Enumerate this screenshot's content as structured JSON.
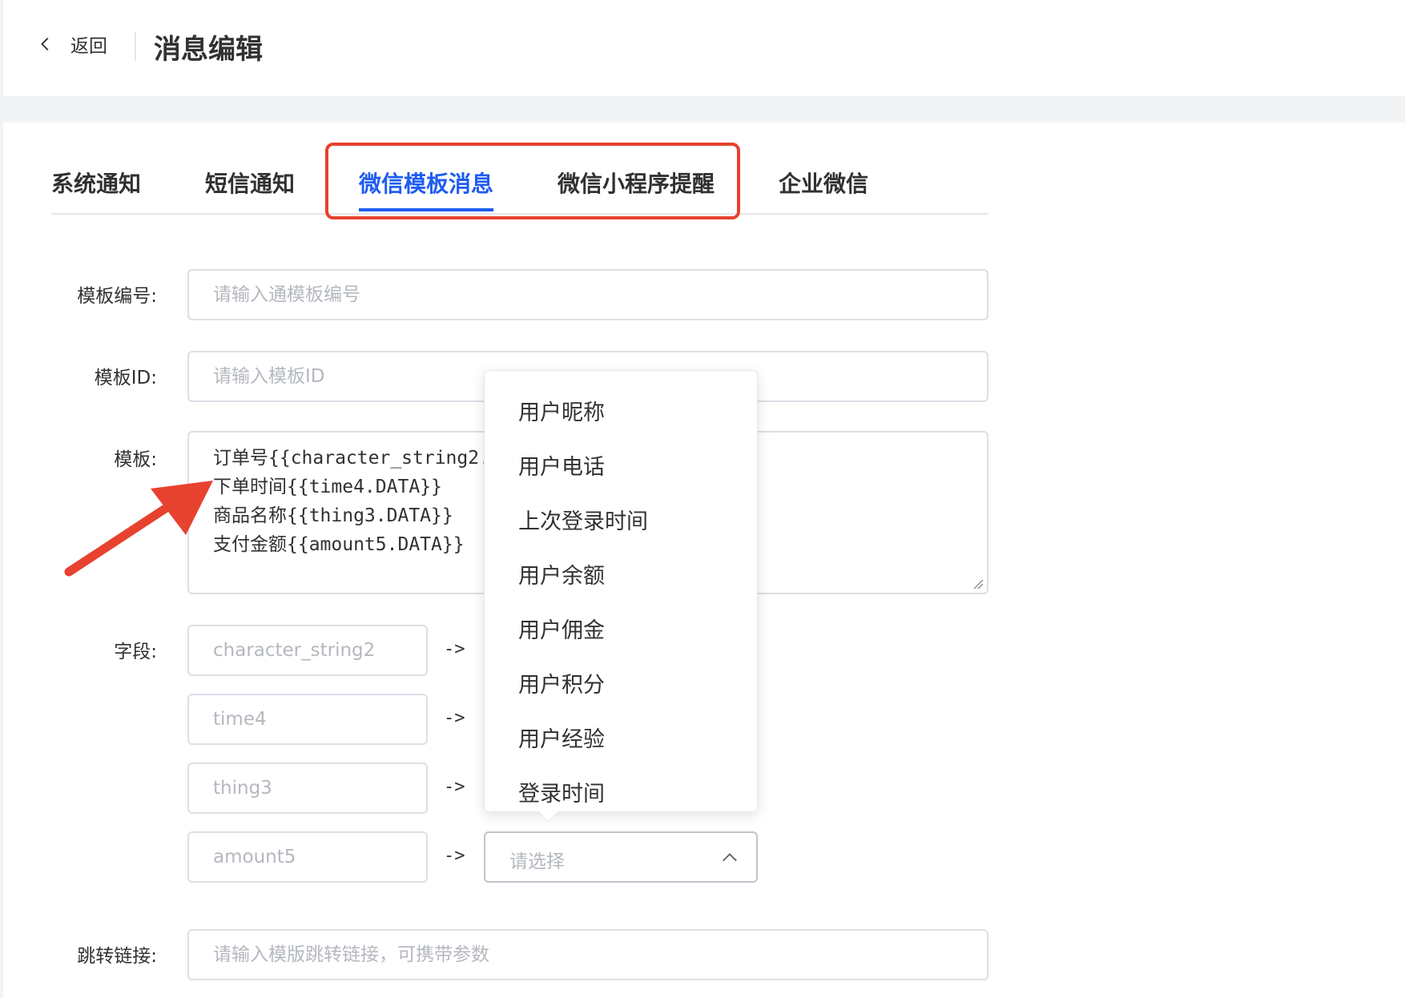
{
  "header": {
    "back_label": "返回",
    "title": "消息编辑"
  },
  "tabs": [
    {
      "label": "系统通知",
      "active": false
    },
    {
      "label": "短信通知",
      "active": false
    },
    {
      "label": "微信模板消息",
      "active": true
    },
    {
      "label": "微信小程序提醒",
      "active": false
    },
    {
      "label": "企业微信",
      "active": false
    }
  ],
  "form": {
    "template_no": {
      "label": "模板编号:",
      "placeholder": "请输入通模板编号"
    },
    "template_id": {
      "label": "模板ID:",
      "placeholder": "请输入模板ID"
    },
    "template": {
      "label": "模板:",
      "value": "订单号{{character_string2.DATA}}\n下单时间{{time4.DATA}}\n商品名称{{thing3.DATA}}\n支付金额{{amount5.DATA}}"
    },
    "fields": {
      "label": "字段:",
      "arrow": "->",
      "rows": [
        {
          "placeholder": "character_string2"
        },
        {
          "placeholder": "time4"
        },
        {
          "placeholder": "thing3"
        },
        {
          "placeholder": "amount5"
        }
      ],
      "select_placeholder": "请选择"
    },
    "jump_link": {
      "label": "跳转链接:",
      "placeholder": "请输入模版跳转链接，可携带参数"
    }
  },
  "dropdown": {
    "options": [
      "用户昵称",
      "用户电话",
      "上次登录时间",
      "用户余额",
      "用户佣金",
      "用户积分",
      "用户经验",
      "登录时间"
    ]
  },
  "colors": {
    "accent": "#1f5cf0",
    "highlight": "#e7422f",
    "border": "#dcdfe6",
    "placeholder": "#b4b8bf"
  }
}
